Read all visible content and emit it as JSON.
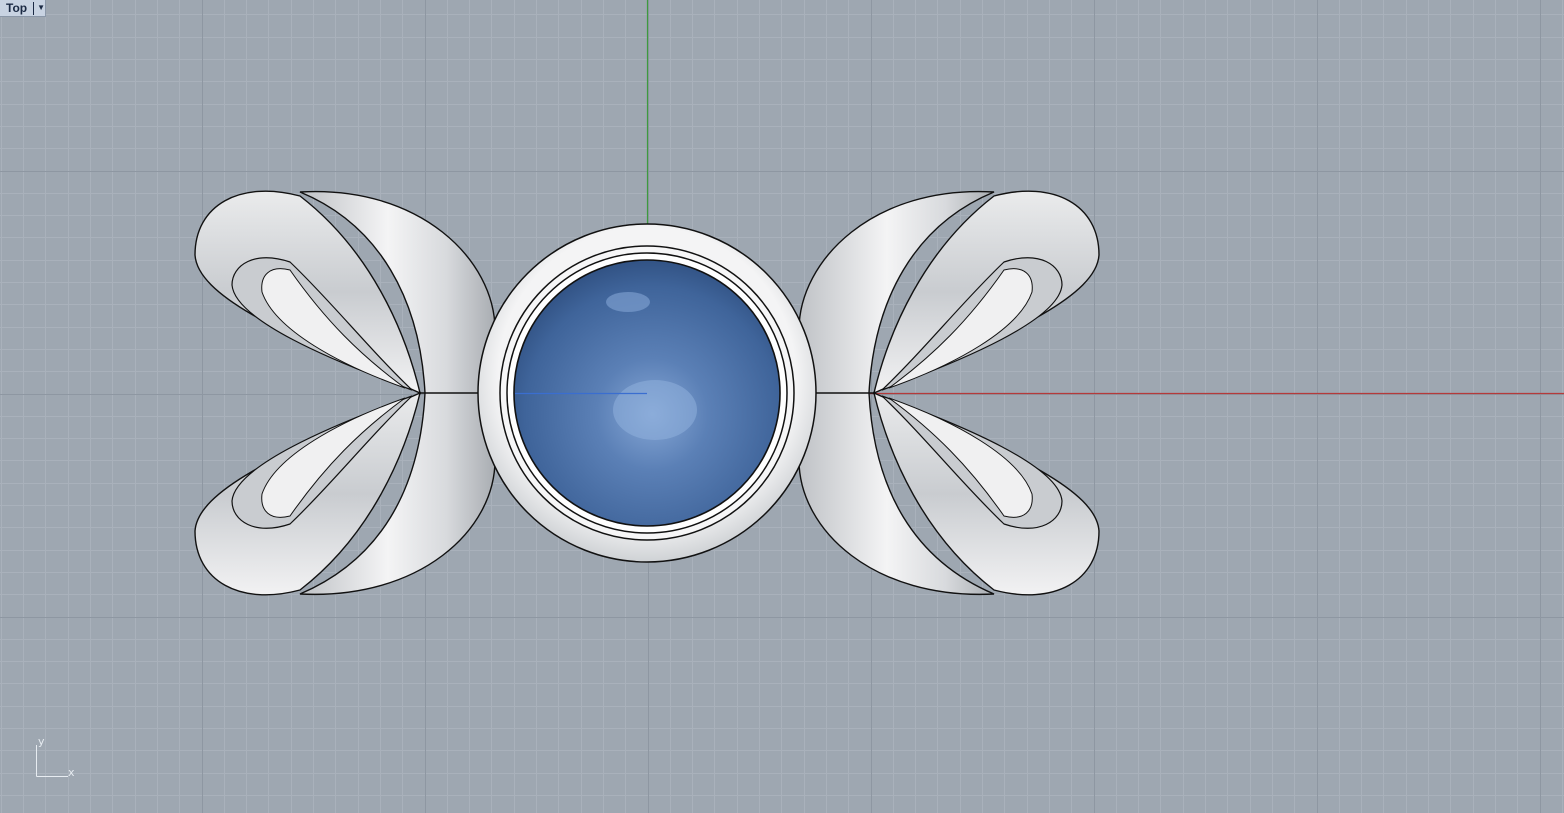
{
  "viewport": {
    "name": "Top",
    "menu_icon": "dropdown-arrow-icon"
  },
  "axis_widget": {
    "x_label": "x",
    "y_label": "y"
  },
  "colors": {
    "background": "#9ea7b1",
    "grid_minor": "#a9b1bb",
    "grid_major": "#8e97a2",
    "x_axis": "#b53a3a",
    "y_axis": "#3e9a3e",
    "gem": "#4f74aa",
    "metal": "#e6e7e9"
  }
}
